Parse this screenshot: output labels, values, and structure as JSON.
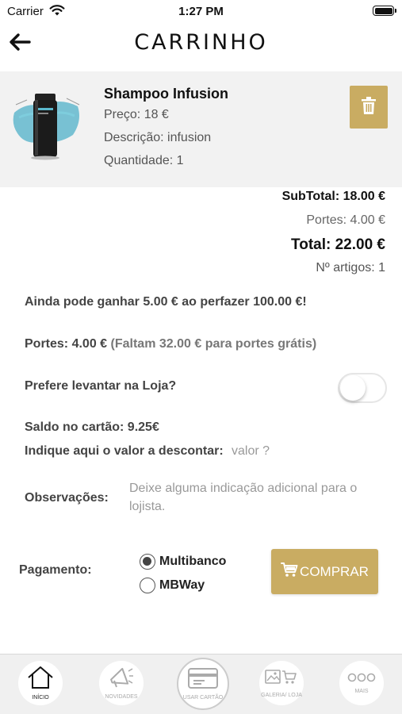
{
  "status_bar": {
    "carrier": "Carrier",
    "time": "1:27 PM"
  },
  "header": {
    "title": "CARRINHO"
  },
  "cart_item": {
    "name": "Shampoo Infusion",
    "price": "Preço: 18 €",
    "description": "Descrição: infusion",
    "quantity": "Quantidade: 1"
  },
  "totals": {
    "subtotal": "SubTotal: 18.00 €",
    "portes": "Portes: 4.00 €",
    "total": "Total: 22.00 €",
    "artigos": "Nº artigos: 1"
  },
  "info": {
    "ganhar": "Ainda pode ganhar 5.00 € ao perfazer 100.00 €!",
    "portes_label": "Portes: 4.00 €",
    "portes_note": "(Faltam 32.00 € para portes grátis)",
    "levantar": "Prefere levantar na Loja?",
    "levantar_toggle": false,
    "saldo": "Saldo no cartão: 9.25€",
    "indique": "Indique aqui o valor a descontar:",
    "valor_placeholder": "valor ?",
    "observacoes": "Observações:",
    "observacoes_placeholder": "Deixe alguma indicação adicional para o lojista."
  },
  "payment": {
    "label": "Pagamento:",
    "options": [
      {
        "label": "Multibanco",
        "selected": true
      },
      {
        "label": "MBWay",
        "selected": false
      }
    ],
    "buy_label": "COMPRAR"
  },
  "tabbar": {
    "tabs": [
      {
        "label": "INÍCIO",
        "icon": "home-icon",
        "active": true
      },
      {
        "label": "NOVIDADES",
        "icon": "megaphone-icon",
        "active": false
      },
      {
        "label": "USAR CARTÃO",
        "icon": "card-icon",
        "active": false
      },
      {
        "label": "GALERIA/ LOJA",
        "icon": "gallery-cart-icon",
        "active": false
      },
      {
        "label": "MAIS",
        "icon": "more-icon",
        "active": false
      }
    ]
  },
  "colors": {
    "accent": "#c9ac62",
    "item_bg": "#f2f2f2",
    "tabbar_bg": "#f0f0f0"
  }
}
